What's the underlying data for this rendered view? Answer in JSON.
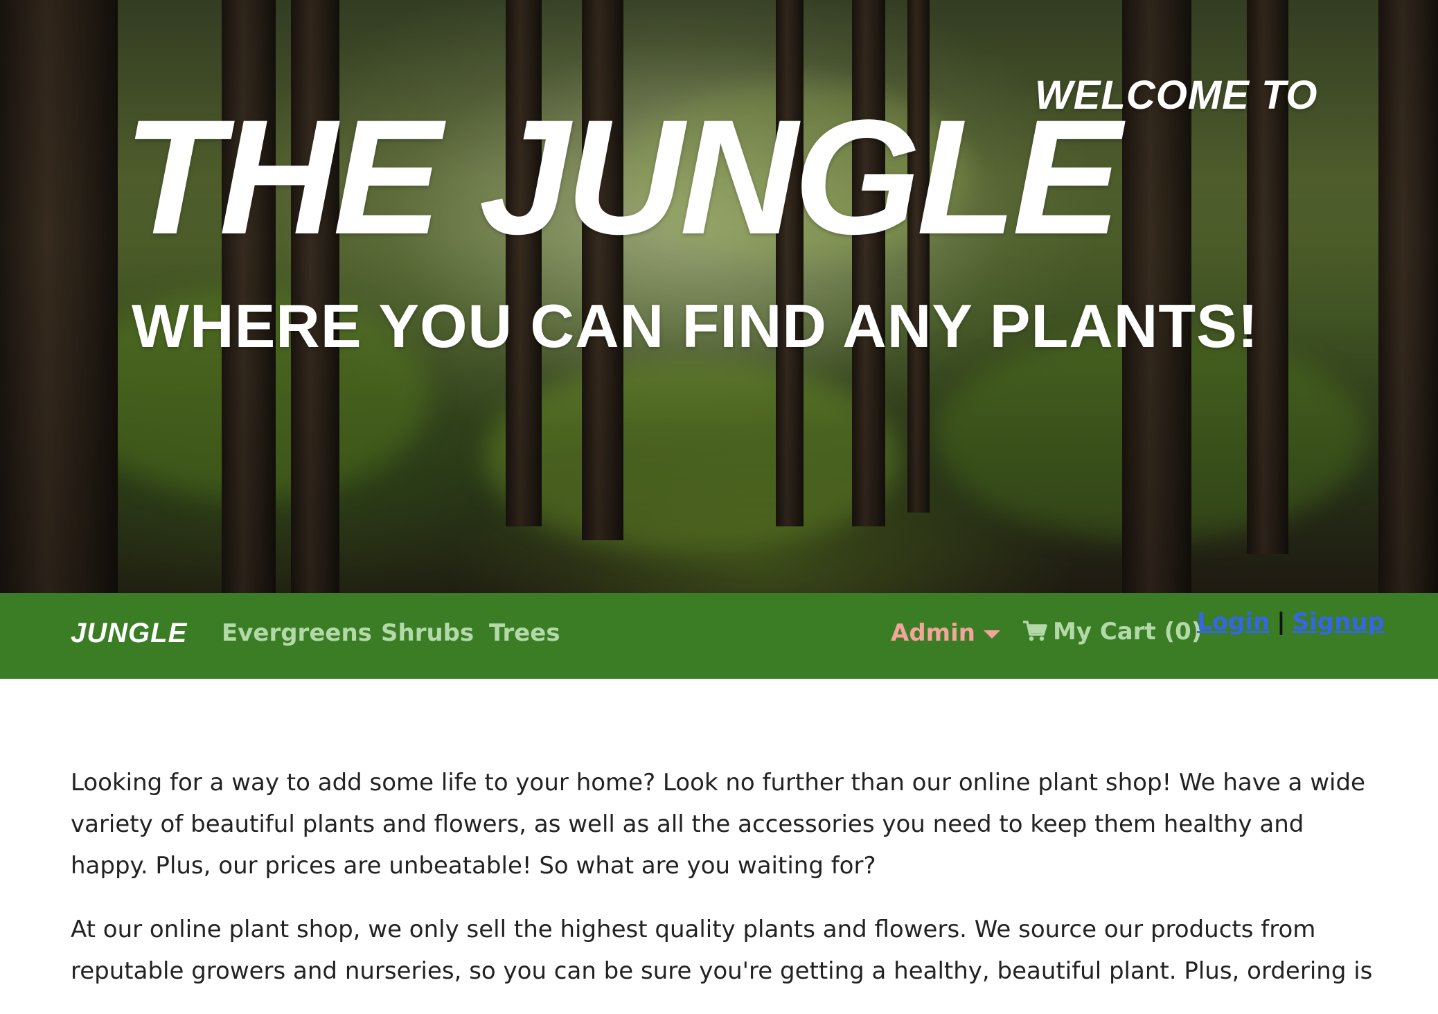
{
  "hero": {
    "welcome": "WELCOME TO",
    "title": "THE JUNGLE",
    "tagline": "WHERE YOU CAN FIND ANY PLANTS!"
  },
  "navbar": {
    "brand": "JUNGLE",
    "links": [
      "Evergreens",
      "Shrubs",
      "Trees"
    ],
    "admin_label": "Admin",
    "cart_label": "My Cart (0)",
    "login_label": "Login",
    "separator": "|",
    "signup_label": "Signup"
  },
  "content": {
    "paragraphs": [
      "Looking for a way to add some life to your home? Look no further than our online plant shop! We have a wide variety of beautiful plants and flowers, as well as all the accessories you need to keep them healthy and happy. Plus, our prices are unbeatable! So what are you waiting for?",
      "At our online plant shop, we only sell the highest quality plants and flowers. We source our products from reputable growers and nurseries, so you can be sure you're getting a healthy, beautiful plant. Plus, ordering is"
    ]
  },
  "colors": {
    "navbar_bg": "#3a7d25",
    "nav_link": "#b3d9a8",
    "admin": "#f2a59a",
    "auth_link": "#3566e6"
  },
  "icons": {
    "cart": "shopping-cart-icon",
    "admin_caret": "caret-down-icon"
  }
}
